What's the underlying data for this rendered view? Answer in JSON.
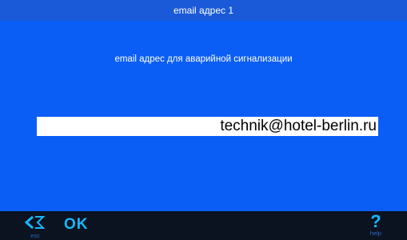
{
  "window": {
    "title": "email адрес 1"
  },
  "main": {
    "subtitle": "email адрес для аварийной сигнализации",
    "email_value": "technik@hotel-berlin.ru"
  },
  "bottombar": {
    "back_hint": "esc",
    "ok_label": "OK",
    "help_symbol": "?",
    "help_hint": "help"
  },
  "colors": {
    "title_bar": "#1a5ad8",
    "main_bg": "#0a5ef5",
    "bottom_bar": "#0b1220",
    "accent": "#14b9ff",
    "field_bg": "#ffffff"
  },
  "icons": {
    "back": "backspace-arrow-icon",
    "help": "question-mark-icon"
  }
}
